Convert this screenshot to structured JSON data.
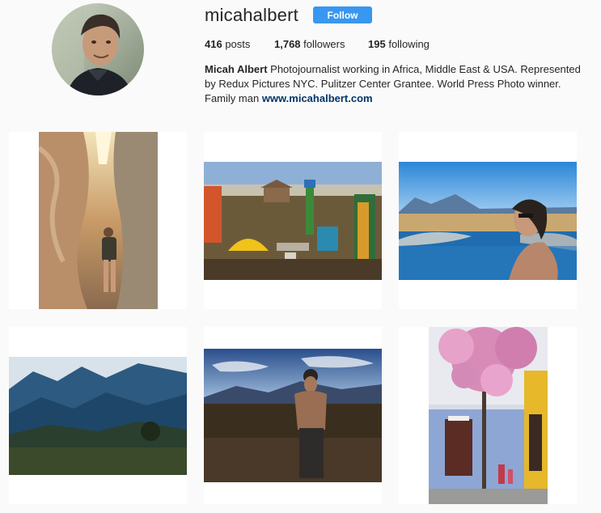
{
  "profile": {
    "username": "micahalbert",
    "follow_label": "Follow",
    "stats": {
      "posts_count": "416",
      "posts_label": "posts",
      "followers_count": "1,768",
      "followers_label": "followers",
      "following_count": "195",
      "following_label": "following"
    },
    "bio": {
      "name": "Micah Albert",
      "text": "Photojournalist working in Africa, Middle East & USA. Represented by Redux Pictures NYC. Pulitzer Center Grantee. World Press Photo winner. Family man",
      "link": "www.micahalbert.com"
    }
  },
  "posts": [
    {
      "id": "post-canyon"
    },
    {
      "id": "post-water-collection"
    },
    {
      "id": "post-hot-spring"
    },
    {
      "id": "post-mountain-valley"
    },
    {
      "id": "post-desert-portrait"
    },
    {
      "id": "post-pink-tree-street"
    }
  ],
  "colors": {
    "follow_button": "#3897f0",
    "link": "#003569",
    "text": "#262626",
    "background": "#fafafa"
  }
}
